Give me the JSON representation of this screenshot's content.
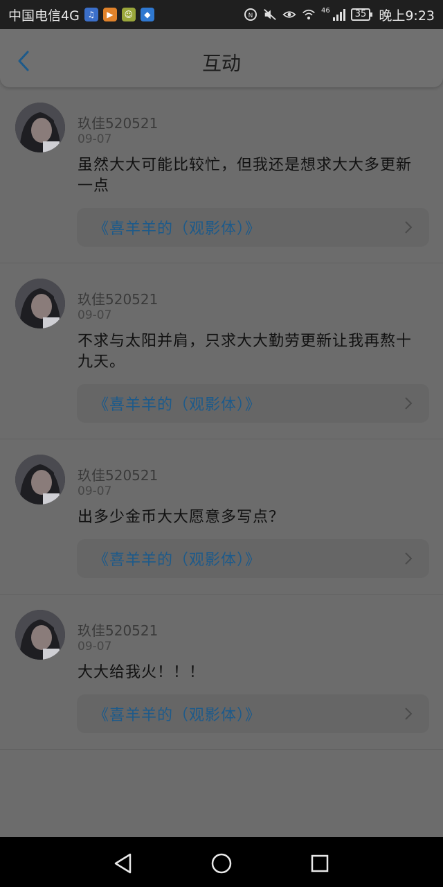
{
  "status_bar": {
    "carrier": "中国电信4G",
    "network_badge": "46",
    "battery": "35",
    "time": "晚上9:23",
    "icons": [
      "music-app-icon",
      "video-app-icon",
      "chat-app-icon",
      "browser-app-icon",
      "nfc-icon",
      "mute-icon",
      "eye-comfort-icon",
      "wifi-icon",
      "signal-icon"
    ]
  },
  "header": {
    "title": "互动",
    "back_icon": "chevron-left-icon"
  },
  "comments": [
    {
      "user": "玖佳520521",
      "date": "09-07",
      "text": "虽然大大可能比较忙，但我还是想求大大多更新一点",
      "book": "《喜羊羊的（观影体）》"
    },
    {
      "user": "玖佳520521",
      "date": "09-07",
      "text": "不求与太阳并肩，只求大大勤劳更新让我再熬十九天。",
      "book": "《喜羊羊的（观影体）》"
    },
    {
      "user": "玖佳520521",
      "date": "09-07",
      "text": "出多少金币大大愿意多写点？",
      "book": "《喜羊羊的（观影体）》"
    },
    {
      "user": "玖佳520521",
      "date": "09-07",
      "text": "大大给我火！！！",
      "book": "《喜羊羊的（观影体）》"
    }
  ],
  "nav_bar": {
    "icons": [
      "back-triangle-icon",
      "home-circle-icon",
      "recents-square-icon"
    ]
  },
  "colors": {
    "accent": "#1d5a8a",
    "dim_overlay_bg": "#6c6c6c"
  }
}
